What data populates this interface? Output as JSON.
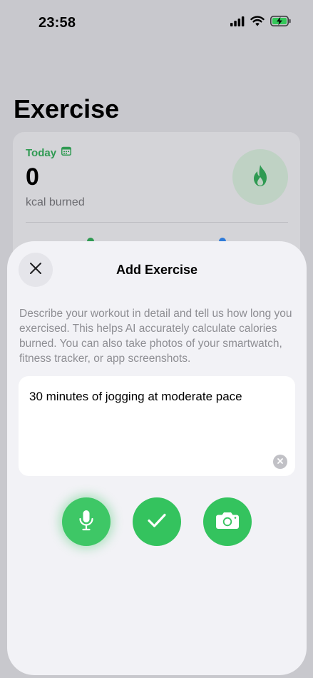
{
  "status_bar": {
    "time": "23:58"
  },
  "background_page": {
    "title": "Exercise",
    "summary": {
      "today_label": "Today",
      "kcal_value": "0",
      "kcal_label": "kcal burned"
    }
  },
  "sheet": {
    "title": "Add Exercise",
    "instructions": "Describe your workout in detail and tell us how long you exercised. This helps AI accurately calculate calories burned. You can also take photos of your smartwatch, fitness tracker, or app screenshots.",
    "input_value": "30 minutes of jogging at moderate pace"
  },
  "icons": {
    "close": "close-icon",
    "clear": "clear-icon",
    "mic": "microphone-icon",
    "check": "checkmark-icon",
    "camera": "camera-icon",
    "flame": "flame-icon",
    "calendar": "calendar-icon"
  },
  "colors": {
    "accent_green": "#34c35e",
    "today_green": "#2f9a52",
    "sheet_bg": "#f2f2f6"
  }
}
